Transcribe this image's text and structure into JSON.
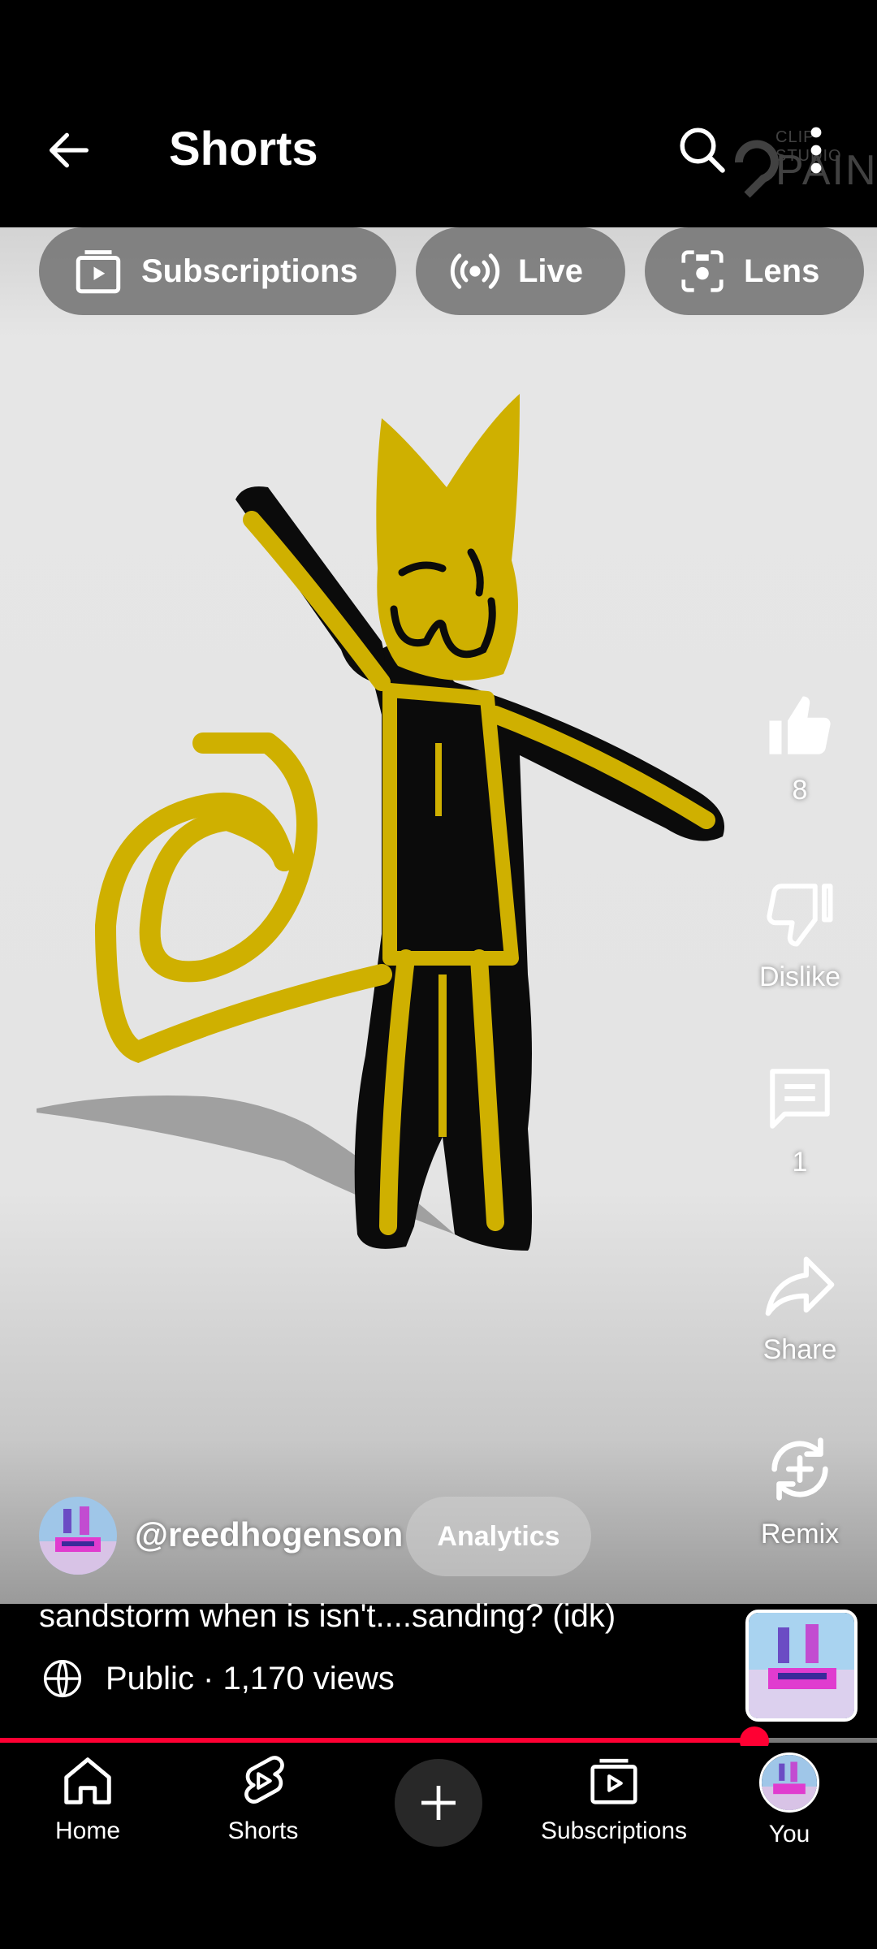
{
  "header": {
    "title": "Shorts",
    "back_icon": "arrow-left-icon",
    "search_icon": "search-icon",
    "more_icon": "more-vert-icon",
    "watermark_small": "CLIP STUDIO",
    "watermark_big": "PAINT"
  },
  "chips": [
    {
      "label": "Subscriptions",
      "icon": "subscriptions-icon"
    },
    {
      "label": "Live",
      "icon": "live-icon"
    },
    {
      "label": "Lens",
      "icon": "lens-icon"
    }
  ],
  "actions": {
    "like_count": "8",
    "dislike_label": "Dislike",
    "comment_count": "1",
    "share_label": "Share",
    "remix_label": "Remix"
  },
  "channel": {
    "handle": "@reedhogenson",
    "analytics_label": "Analytics"
  },
  "video": {
    "caption": "sandstorm when is isn't....sanding? (idk)",
    "visibility_text": "Public · 1,170 views",
    "progress_fraction": 0.86
  },
  "colors": {
    "accent_red": "#ff0033",
    "cat_yellow": "#cfb000"
  },
  "nav": [
    {
      "label": "Home",
      "icon": "home-icon"
    },
    {
      "label": "Shorts",
      "icon": "shorts-icon"
    },
    {
      "label": "",
      "icon": "plus-icon"
    },
    {
      "label": "Subscriptions",
      "icon": "subscriptions-icon"
    },
    {
      "label": "You",
      "icon": "avatar"
    }
  ]
}
